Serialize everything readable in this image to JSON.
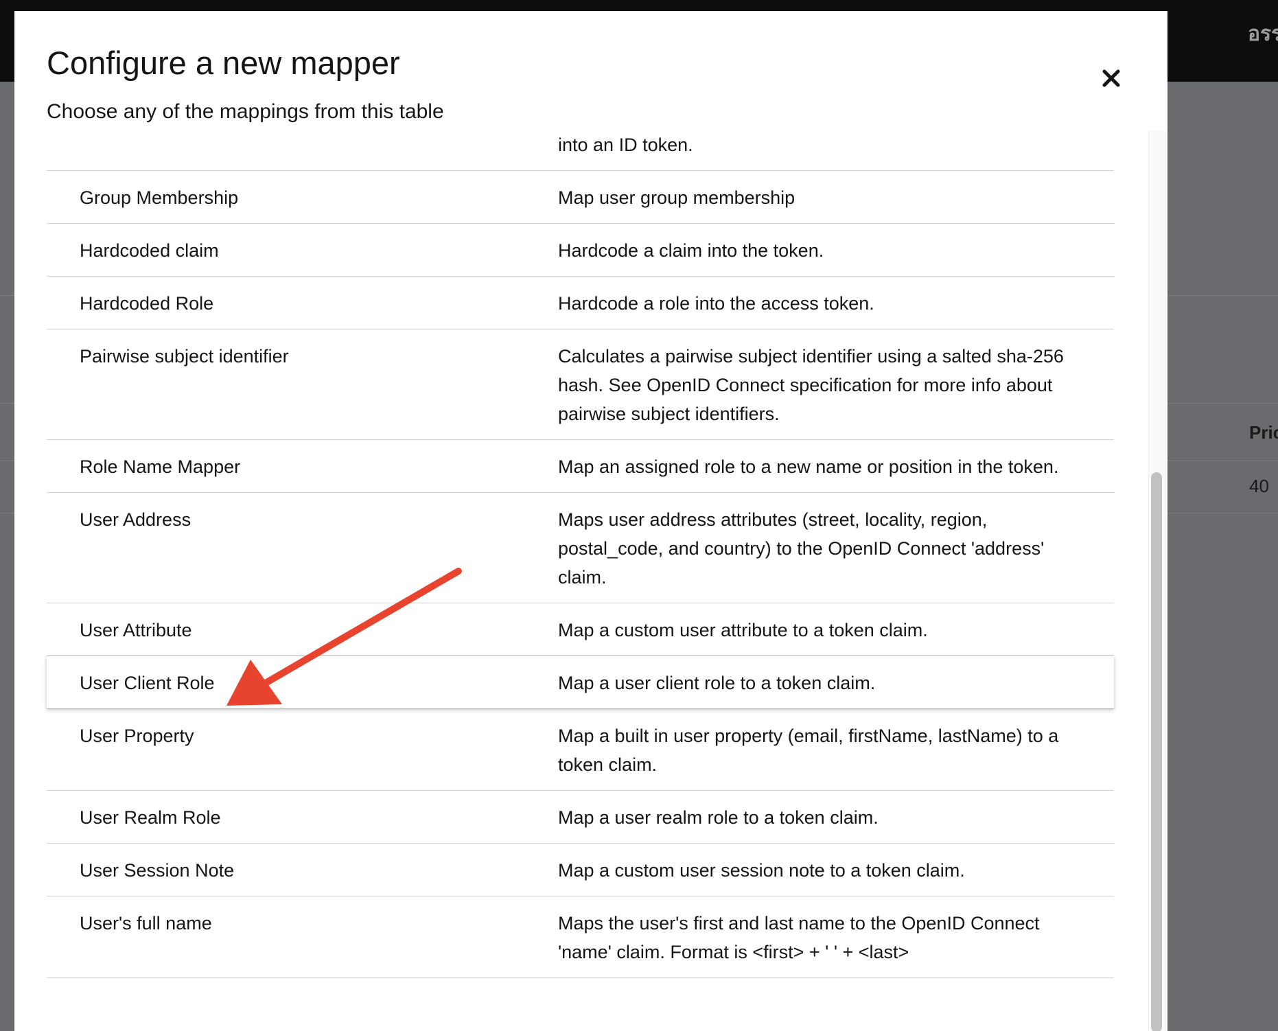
{
  "background": {
    "topbar_text": "อรร",
    "table_header": "Pric",
    "table_cell": "40"
  },
  "modal": {
    "title": "Configure a new mapper",
    "subtitle": "Choose any of the mappings from this table",
    "close_icon": "close-icon"
  },
  "mappers": [
    {
      "name": "",
      "description": "into an ID token."
    },
    {
      "name": "Group Membership",
      "description": "Map user group membership"
    },
    {
      "name": "Hardcoded claim",
      "description": "Hardcode a claim into the token."
    },
    {
      "name": "Hardcoded Role",
      "description": "Hardcode a role into the access token."
    },
    {
      "name": "Pairwise subject identifier",
      "description": "Calculates a pairwise subject identifier using a salted sha-256 hash. See OpenID Connect specification for more info about pairwise subject identifiers."
    },
    {
      "name": "Role Name Mapper",
      "description": "Map an assigned role to a new name or position in the token."
    },
    {
      "name": "User Address",
      "description": "Maps user address attributes (street, locality, region, postal_code, and country) to the OpenID Connect 'address' claim."
    },
    {
      "name": "User Attribute",
      "description": "Map a custom user attribute to a token claim."
    },
    {
      "name": "User Client Role",
      "description": "Map a user client role to a token claim."
    },
    {
      "name": "User Property",
      "description": "Map a built in user property (email, firstName, lastName) to a token claim."
    },
    {
      "name": "User Realm Role",
      "description": "Map a user realm role to a token claim."
    },
    {
      "name": "User Session Note",
      "description": "Map a custom user session note to a token claim."
    },
    {
      "name": "User's full name",
      "description": "Maps the user's first and last name to the OpenID Connect 'name' claim. Format is <first> + ' ' + <last>"
    }
  ],
  "hovered_row_index": 8,
  "colors": {
    "annotation_arrow": "#e8432e",
    "text": "#151515",
    "row_border": "#d2d2d2"
  }
}
